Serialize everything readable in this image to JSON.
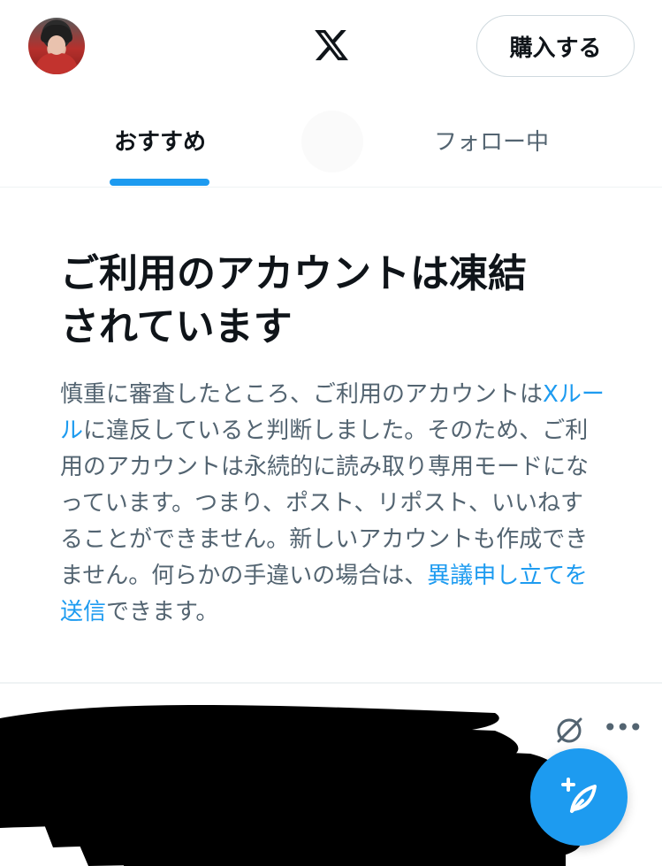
{
  "header": {
    "logo_icon": "x-logo-icon",
    "buy_label": "購入する"
  },
  "tabs": [
    {
      "label": "おすすめ",
      "active": true
    },
    {
      "label": "フォロー中",
      "active": false
    }
  ],
  "notice": {
    "title_line1": "ご利用のアカウントは凍結",
    "title_line2": "されています",
    "body_part1": "慎重に審査したところ、ご利用のアカウントは",
    "body_link1": "Xルール",
    "body_part2": "に違反していると判断しました。そのため、ご利用のアカウントは永続的に読み取り専用モードになっています。つまり、ポスト、リポスト、いいねすることができません。新しいアカウントも作成できません。何らかの手違いの場合は、",
    "body_link2": "異議申し立てを送信",
    "body_part3": "できます。"
  },
  "post": {
    "more_label": "•••",
    "redacted": true
  },
  "colors": {
    "accent": "#1d9bf0",
    "text_primary": "#0f1419",
    "text_secondary": "#536471",
    "border": "#eff3f4"
  }
}
